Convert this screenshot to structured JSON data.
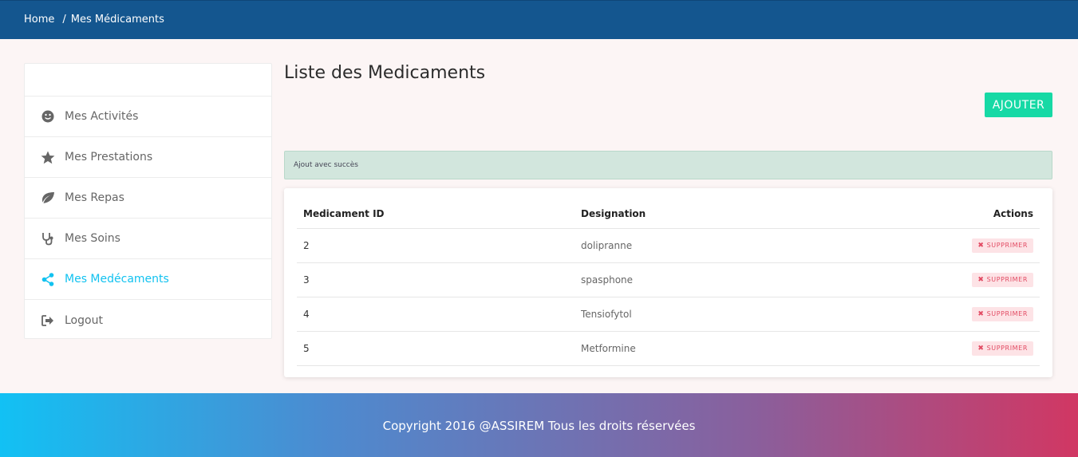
{
  "breadcrumb": {
    "home": "Home",
    "separator": "/",
    "current": "Mes Médicaments"
  },
  "sidebar": {
    "items": [
      {
        "label": "Mes Activités",
        "icon": "smile-icon"
      },
      {
        "label": "Mes Prestations",
        "icon": "star-icon"
      },
      {
        "label": "Mes Repas",
        "icon": "leaf-icon"
      },
      {
        "label": "Mes Soins",
        "icon": "stethoscope-icon"
      },
      {
        "label": "Mes Medécaments",
        "icon": "share-icon",
        "active": true
      },
      {
        "label": "Logout",
        "icon": "logout-icon"
      }
    ]
  },
  "main": {
    "title": "Liste des Medicaments",
    "add_button": "AJOUTER",
    "alert": "Ajout avec succès"
  },
  "table": {
    "headers": [
      "Medicament ID",
      "Designation",
      "Actions"
    ],
    "rows": [
      {
        "id": "2",
        "designation": "dolipranne",
        "action": "SUPPRIMER"
      },
      {
        "id": "3",
        "designation": "spasphone",
        "action": "SUPPRIMER"
      },
      {
        "id": "4",
        "designation": "Tensiofytol",
        "action": "SUPPRIMER"
      },
      {
        "id": "5",
        "designation": "Metformine",
        "action": "SUPPRIMER"
      }
    ]
  },
  "footer": {
    "text": "Copyright 2016 @ASSIREM Tous les droits réservées"
  },
  "colors": {
    "topbar": "#14568f",
    "accent": "#16d9a5",
    "active": "#12c2f0",
    "danger": "#e24b63"
  }
}
